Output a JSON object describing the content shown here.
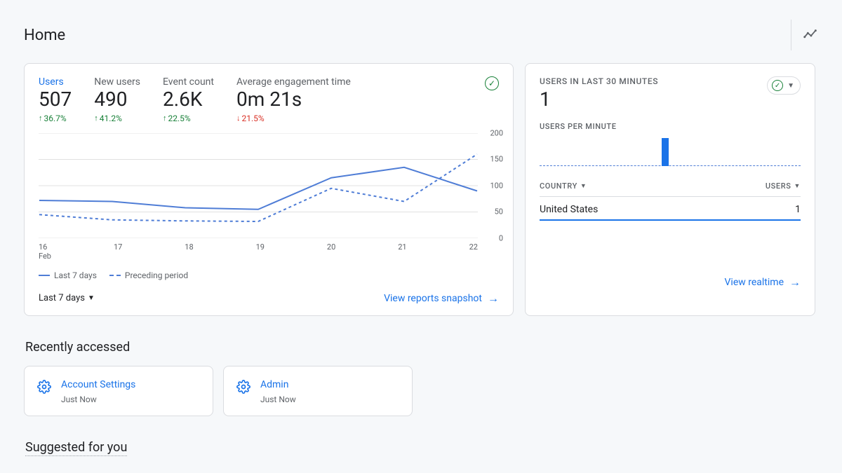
{
  "page": {
    "title": "Home"
  },
  "metrics": [
    {
      "label": "Users",
      "value": "507",
      "delta": "36.7%",
      "dir": "up",
      "active": true
    },
    {
      "label": "New users",
      "value": "490",
      "delta": "41.2%",
      "dir": "up",
      "active": false
    },
    {
      "label": "Event count",
      "value": "2.6K",
      "delta": "22.5%",
      "dir": "up",
      "active": false
    },
    {
      "label": "Average engagement time",
      "value": "0m 21s",
      "delta": "21.5%",
      "dir": "down",
      "active": false
    }
  ],
  "chart_data": {
    "type": "line",
    "title": "",
    "xlabel": "",
    "ylabel": "",
    "ylim": [
      0,
      200
    ],
    "y_ticks": [
      0,
      50,
      100,
      150,
      200
    ],
    "categories": [
      "16",
      "17",
      "18",
      "19",
      "20",
      "21",
      "22"
    ],
    "x_month_for_first": "Feb",
    "series": [
      {
        "name": "Last 7 days",
        "style": "solid",
        "values": [
          72,
          70,
          58,
          55,
          115,
          135,
          90
        ]
      },
      {
        "name": "Preceding period",
        "style": "dashed",
        "values": [
          45,
          35,
          33,
          32,
          95,
          70,
          160
        ]
      }
    ]
  },
  "main_card": {
    "range_label": "Last 7 days",
    "footer_link": "View reports snapshot"
  },
  "legend": {
    "solid": "Last 7 days",
    "dashed": "Preceding period"
  },
  "realtime": {
    "title": "USERS IN LAST 30 MINUTES",
    "value": "1",
    "upm_label": "USERS PER MINUTE",
    "mini_chart": {
      "bars": 30,
      "highlight_index": 14,
      "highlight_height_frac": 1.0
    },
    "columns": {
      "country": "COUNTRY",
      "users": "USERS"
    },
    "rows": [
      {
        "country": "United States",
        "users": "1"
      }
    ],
    "footer_link": "View realtime"
  },
  "recent": {
    "title": "Recently accessed",
    "items": [
      {
        "title": "Account Settings",
        "sub": "Just Now"
      },
      {
        "title": "Admin",
        "sub": "Just Now"
      }
    ]
  },
  "suggested": {
    "title": "Suggested for you"
  }
}
